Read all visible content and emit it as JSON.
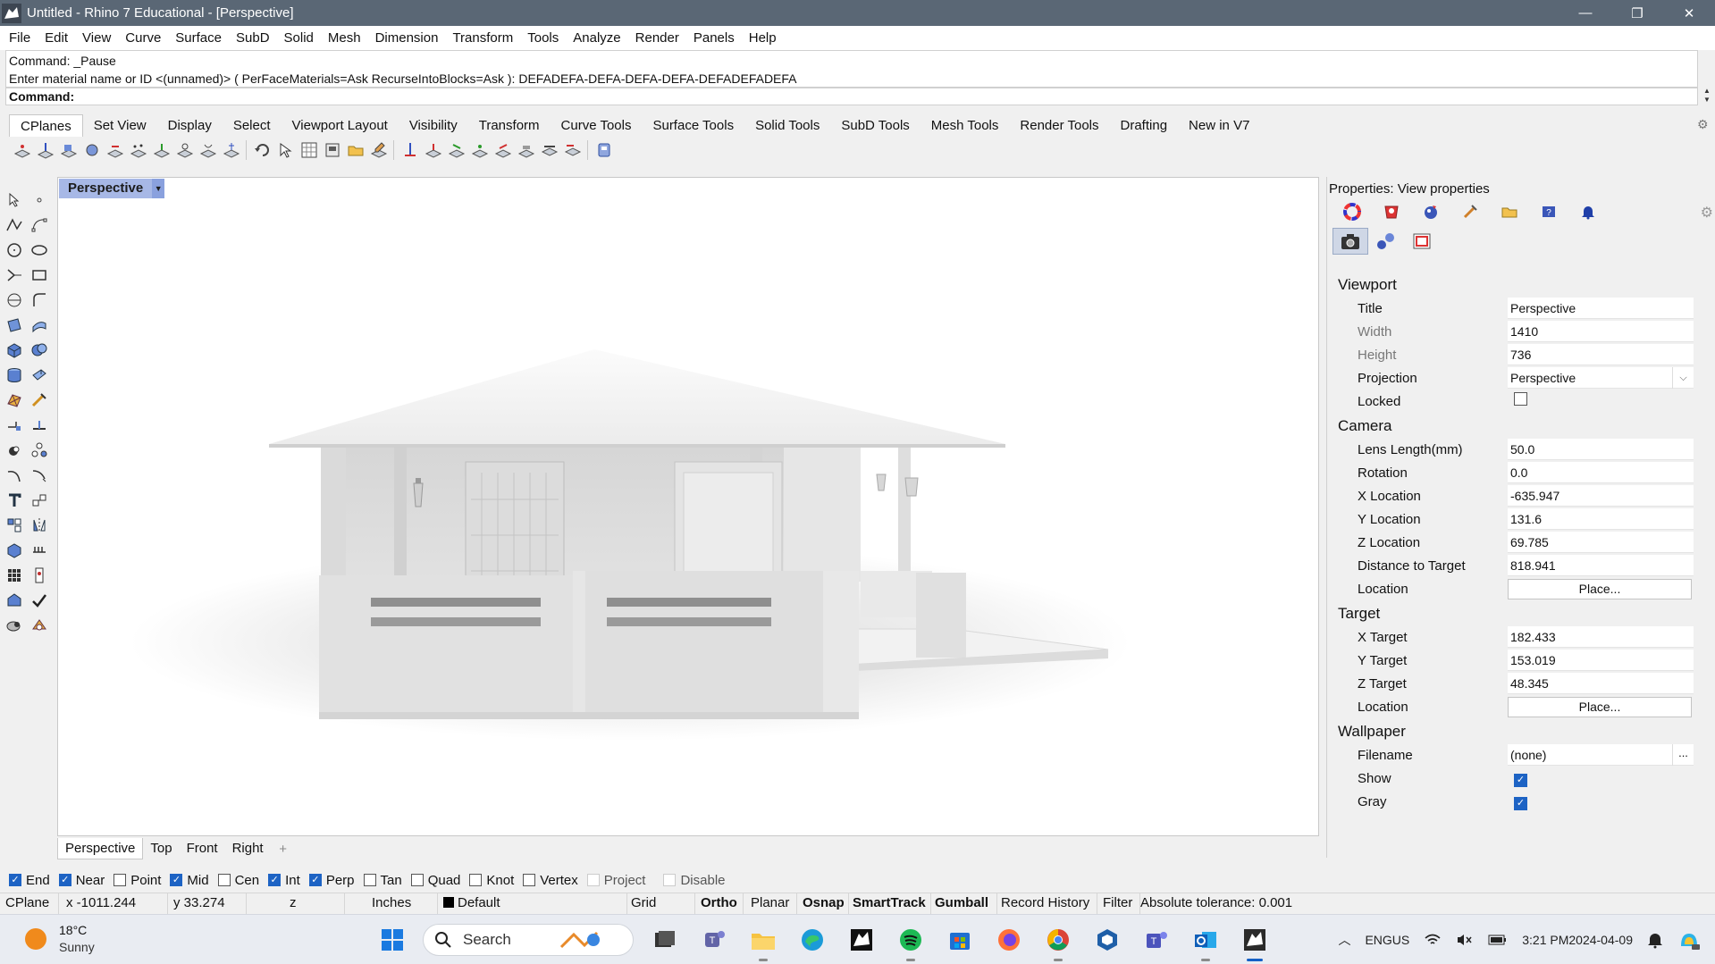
{
  "window": {
    "title": "Untitled - Rhino 7 Educational - [Perspective]",
    "minimize": "—",
    "maximize": "❐",
    "close": "✕"
  },
  "menu": [
    "File",
    "Edit",
    "View",
    "Curve",
    "Surface",
    "SubD",
    "Solid",
    "Mesh",
    "Dimension",
    "Transform",
    "Tools",
    "Analyze",
    "Render",
    "Panels",
    "Help"
  ],
  "command": {
    "history_line1": "Command: _Pause",
    "history_line2": "Enter material name or ID <(unnamed)> ( PerFaceMaterials=Ask  RecurseIntoBlocks=Ask ): DEFADEFA-DEFA-DEFA-DEFA-DEFADEFADEFA",
    "prompt": "Command:"
  },
  "toolbar_tabs": [
    "CPlanes",
    "Set View",
    "Display",
    "Select",
    "Viewport Layout",
    "Visibility",
    "Transform",
    "Curve Tools",
    "Surface Tools",
    "Solid Tools",
    "SubD Tools",
    "Mesh Tools",
    "Render Tools",
    "Drafting",
    "New in V7"
  ],
  "viewport": {
    "title": "Perspective",
    "tabs": [
      "Perspective",
      "Top",
      "Front",
      "Right"
    ],
    "add_tab": "+"
  },
  "properties": {
    "header": "Properties: View properties",
    "sections": {
      "viewport": "Viewport",
      "camera": "Camera",
      "target": "Target",
      "wallpaper": "Wallpaper"
    },
    "viewport_rows": {
      "title_label": "Title",
      "title_value": "Perspective",
      "width_label": "Width",
      "width_value": "1410",
      "height_label": "Height",
      "height_value": "736",
      "projection_label": "Projection",
      "projection_value": "Perspective",
      "locked_label": "Locked"
    },
    "camera_rows": {
      "lens_label": "Lens Length(mm)",
      "lens_value": "50.0",
      "rotation_label": "Rotation",
      "rotation_value": "0.0",
      "xloc_label": "X Location",
      "xloc_value": "-635.947",
      "yloc_label": "Y Location",
      "yloc_value": "131.6",
      "zloc_label": "Z Location",
      "zloc_value": "69.785",
      "dist_label": "Distance to Target",
      "dist_value": "818.941",
      "location_label": "Location",
      "place_button": "Place..."
    },
    "target_rows": {
      "xt_label": "X Target",
      "xt_value": "182.433",
      "yt_label": "Y Target",
      "yt_value": "153.019",
      "zt_label": "Z Target",
      "zt_value": "48.345",
      "location_label": "Location",
      "place_button": "Place..."
    },
    "wallpaper_rows": {
      "filename_label": "Filename",
      "filename_value": "(none)",
      "browse": "...",
      "show_label": "Show",
      "gray_label": "Gray"
    }
  },
  "osnaps": {
    "end": "End",
    "near": "Near",
    "point": "Point",
    "mid": "Mid",
    "cen": "Cen",
    "int": "Int",
    "perp": "Perp",
    "tan": "Tan",
    "quad": "Quad",
    "knot": "Knot",
    "vertex": "Vertex",
    "project": "Project",
    "disable": "Disable"
  },
  "status": {
    "cplane": "CPlane",
    "x": "x -1011.244",
    "y": "y 33.274",
    "z": "z",
    "units": "Inches",
    "layer": "Default",
    "grid_snap": "Grid Snap",
    "ortho": "Ortho",
    "planar": "Planar",
    "osnap": "Osnap",
    "smarttrack": "SmartTrack",
    "gumball": "Gumball",
    "record_history": "Record History",
    "filter": "Filter",
    "tolerance": "Absolute tolerance: 0.001"
  },
  "taskbar": {
    "temperature": "18°C",
    "condition": "Sunny",
    "search": "Search",
    "lang1": "ENG",
    "lang2": "US",
    "time": "3:21 PM",
    "date": "2024-04-09"
  }
}
